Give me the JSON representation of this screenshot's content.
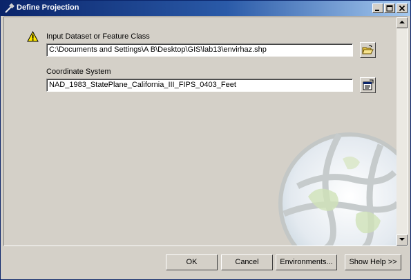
{
  "window": {
    "title": "Define Projection"
  },
  "fields": {
    "input_dataset": {
      "label": "Input Dataset or Feature Class",
      "value": "C:\\Documents and Settings\\A B\\Desktop\\GIS\\lab13\\envirhaz.shp"
    },
    "coordinate_system": {
      "label": "Coordinate System",
      "value": "NAD_1983_StatePlane_California_III_FIPS_0403_Feet"
    }
  },
  "buttons": {
    "ok": "OK",
    "cancel": "Cancel",
    "environments": "Environments...",
    "show_help": "Show Help >>"
  },
  "icons": {
    "warning": "warning-icon",
    "browse": "open-folder-icon",
    "properties": "properties-icon"
  }
}
